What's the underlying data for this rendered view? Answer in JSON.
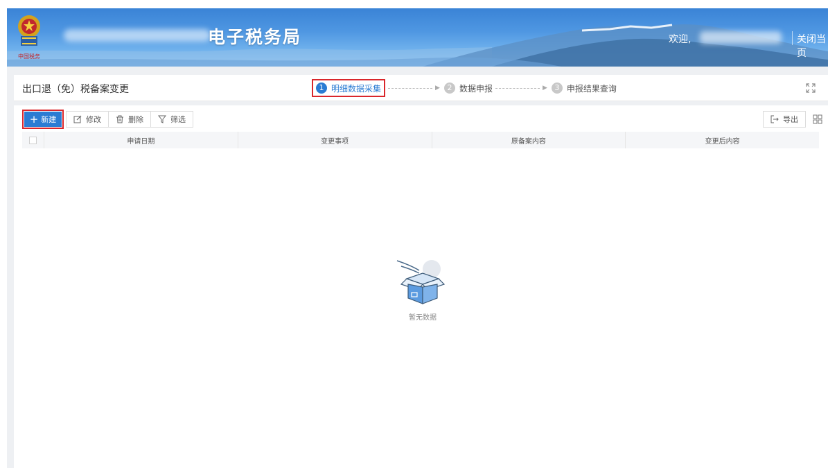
{
  "header": {
    "site_title": "电子税务局",
    "welcome": "欢迎,",
    "close_page": "关闭当页",
    "logo_text": "中国税务"
  },
  "title_bar": {
    "page_title": "出口退（免）税备案变更",
    "steps": [
      {
        "num": "1",
        "label": "明细数据采集",
        "active": true
      },
      {
        "num": "2",
        "label": "数据申报",
        "active": false
      },
      {
        "num": "3",
        "label": "申报结果查询",
        "active": false
      }
    ]
  },
  "toolbar": {
    "new_label": "新建",
    "edit_label": "修改",
    "delete_label": "删除",
    "filter_label": "筛选",
    "export_label": "导出"
  },
  "table": {
    "columns": [
      "申请日期",
      "变更事项",
      "原备案内容",
      "变更后内容"
    ],
    "rows": []
  },
  "empty_state": {
    "text": "暂无数据"
  },
  "colors": {
    "primary": "#2b7cd3",
    "highlight_border": "#d9262b",
    "header_blue": "#3a83d6"
  }
}
